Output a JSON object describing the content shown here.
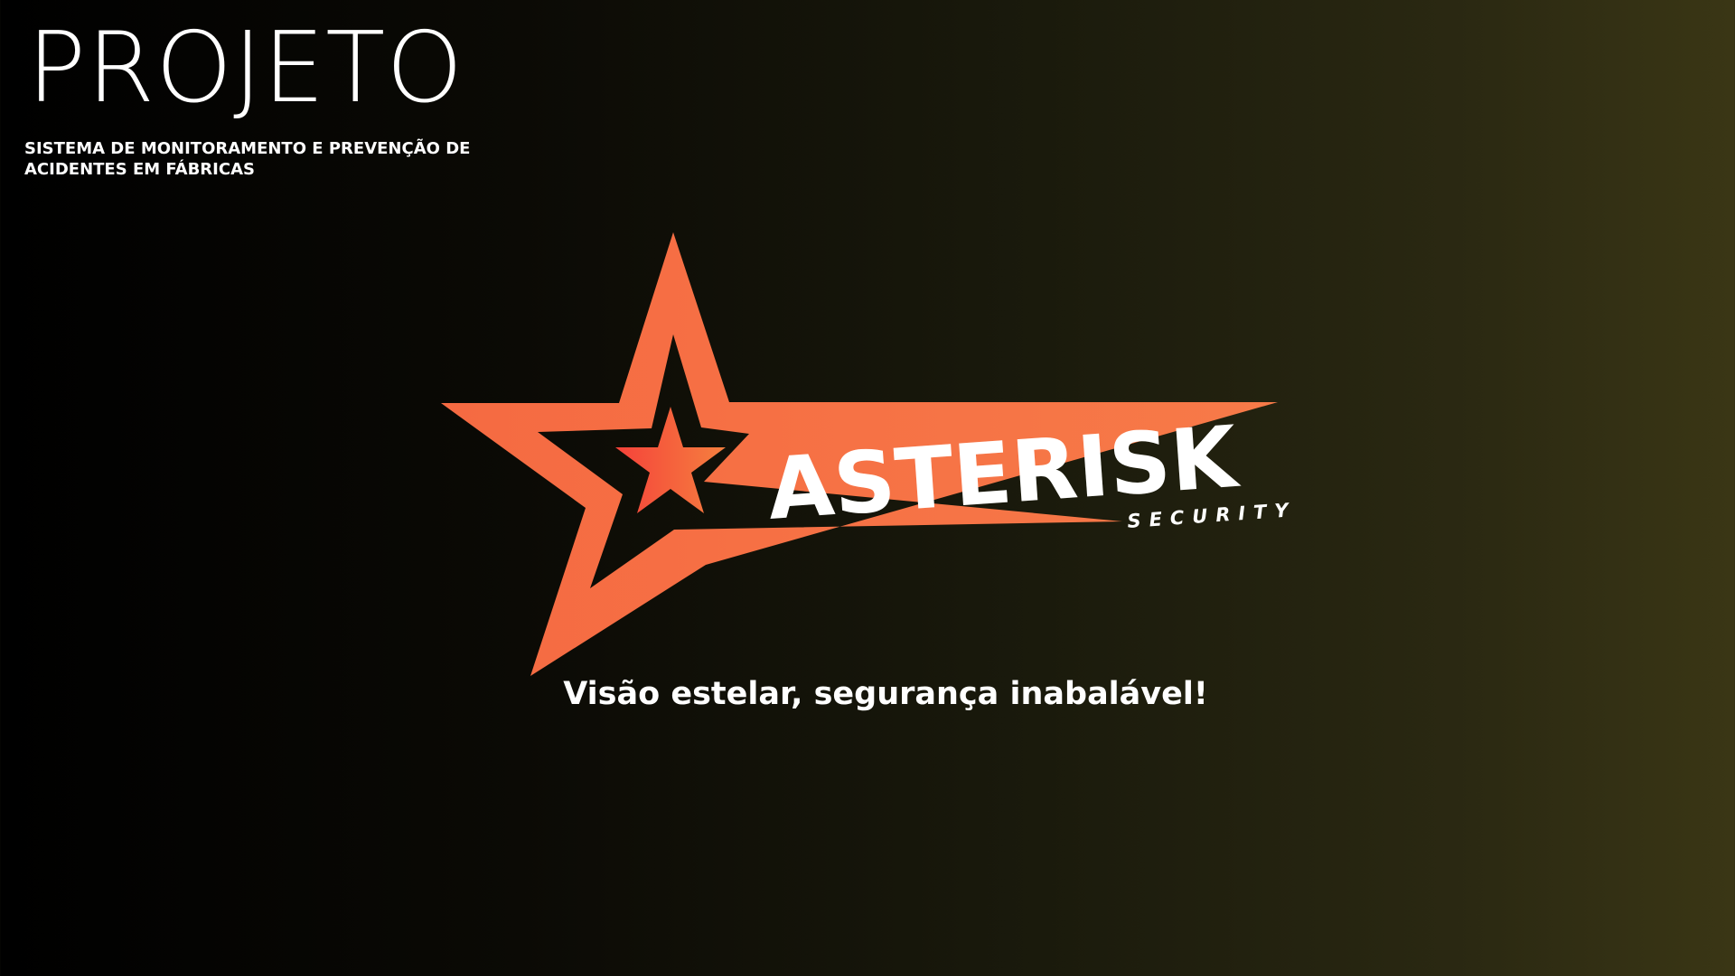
{
  "slide": {
    "title": "PROJETO",
    "subtitle": "SISTEMA DE MONITORAMENTO E PREVENÇÃO DE ACIDENTES EM FÁBRICAS",
    "tagline": "Visão estelar, segurança inabalável!"
  },
  "logo": {
    "brand_name": "ASTERISK",
    "brand_sub": "SECURITY",
    "colors": {
      "outer_star": "#f56a42",
      "inner_star_start": "#f5423a",
      "inner_star_end": "#f5803f",
      "text": "#ffffff"
    }
  },
  "background": {
    "gradient_start": "#000000",
    "gradient_end": "#3a3615"
  }
}
